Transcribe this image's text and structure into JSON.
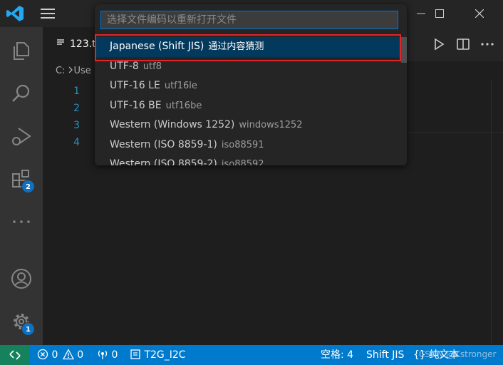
{
  "quick_pick": {
    "placeholder": "选择文件编码以重新打开文件",
    "items": [
      {
        "label": "Japanese (Shift JIS)",
        "description": "通过内容猜测"
      },
      {
        "label": "UTF-8",
        "description": "utf8"
      },
      {
        "label": "UTF-16 LE",
        "description": "utf16le"
      },
      {
        "label": "UTF-16 BE",
        "description": "utf16be"
      },
      {
        "label": "Western (Windows 1252)",
        "description": "windows1252"
      },
      {
        "label": "Western (ISO 8859-1)",
        "description": "iso88591"
      },
      {
        "label": "Western (ISO 8859-2)",
        "description": "iso88592"
      }
    ]
  },
  "tab": {
    "label": "123.t"
  },
  "breadcrumb": {
    "drive": "C:",
    "folder": "Use"
  },
  "line_numbers": [
    "1",
    "2",
    "3",
    "4"
  ],
  "activity_bar": {
    "extensions_badge": "2",
    "manage_badge": "1"
  },
  "status_bar": {
    "errors": "0",
    "warnings": "0",
    "ports": "0",
    "branch": "T2G_I2C",
    "spaces": "空格: 4",
    "encoding": "Shift JIS",
    "language": "纯文本"
  },
  "watermark": "CSDN @Kstronger",
  "colors": {
    "accent": "#007acc",
    "selection": "#04395e",
    "highlight_border": "#e0242b",
    "remote": "#16825d"
  }
}
